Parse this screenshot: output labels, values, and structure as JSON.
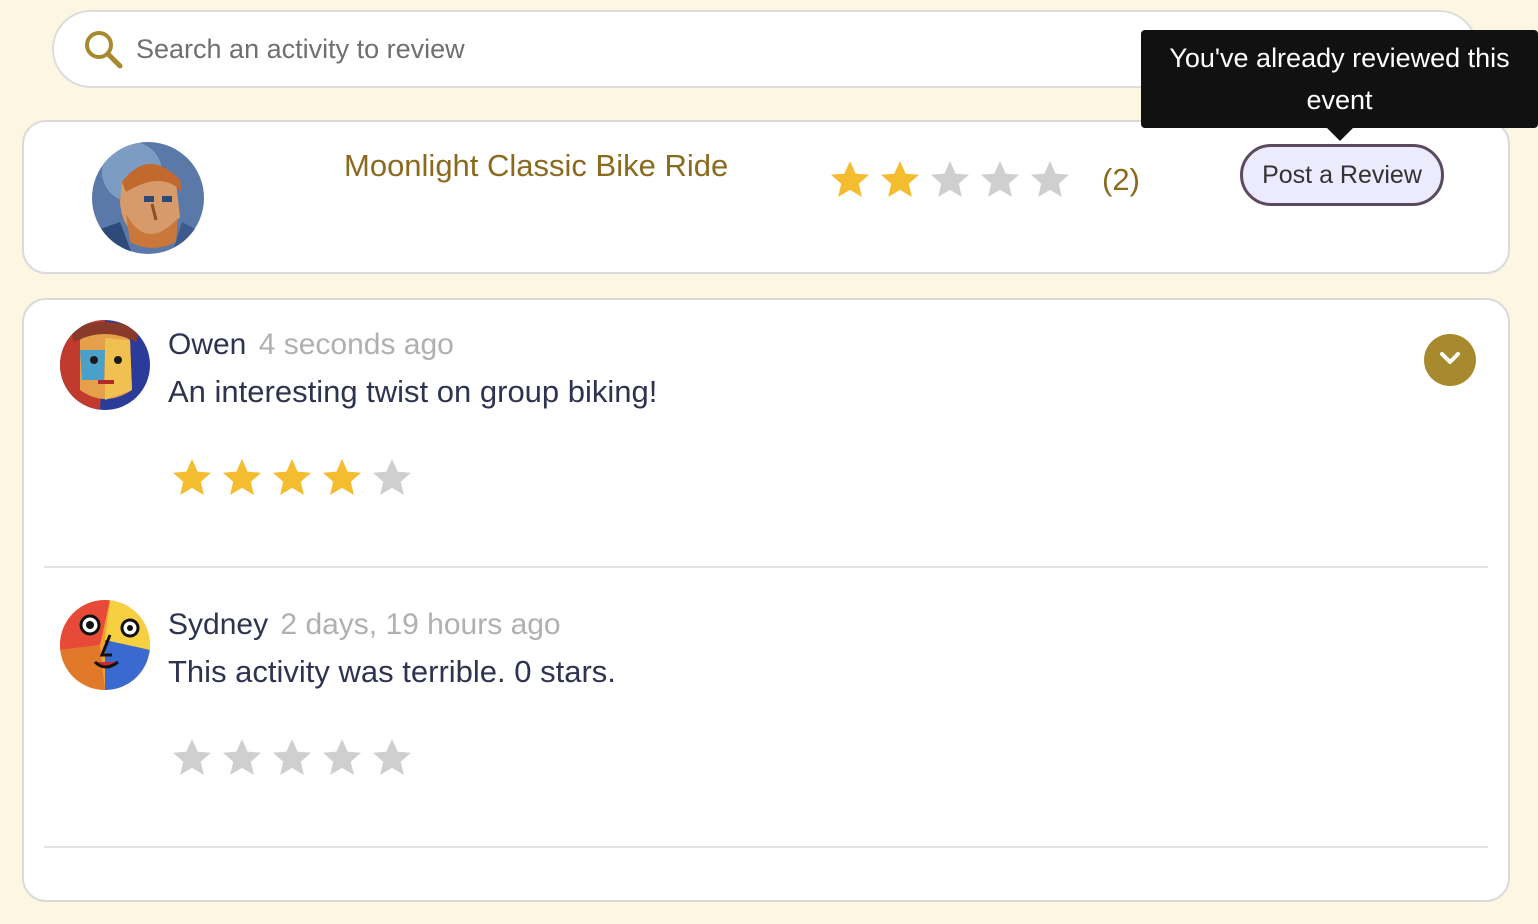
{
  "search": {
    "placeholder": "Search an activity to review",
    "value": ""
  },
  "activity": {
    "title": "Moonlight Classic Bike Ride",
    "rating": 2,
    "max_rating": 5,
    "review_count_label": "(2)",
    "post_button_label": "Post a Review",
    "tooltip": "You've already reviewed this event",
    "avatar_icon": "painted-portrait-avatar"
  },
  "reviews": [
    {
      "name": "Owen",
      "time": "4 seconds ago",
      "text": "An interesting twist on group biking!",
      "rating": 4,
      "avatar_icon": "cubist-face-avatar"
    },
    {
      "name": "Sydney",
      "time": "2 days, 19 hours ago",
      "text": "This activity was terrible. 0 stars.",
      "rating": 0,
      "avatar_icon": "pop-art-face-avatar"
    }
  ],
  "colors": {
    "background": "#fdf6e3",
    "accent": "#8a6a1e",
    "star_filled": "#f4bd30",
    "star_empty": "#cfcfcf",
    "button_bg": "#eceafd",
    "expand_bg": "#a88a2e"
  }
}
